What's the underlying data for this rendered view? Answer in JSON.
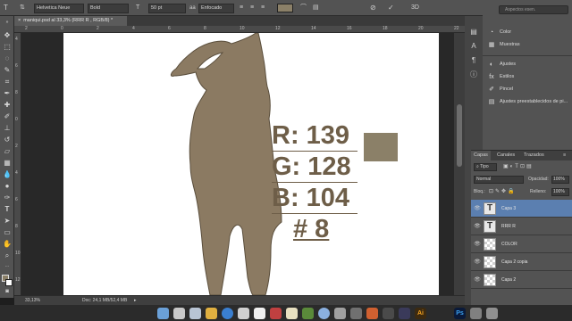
{
  "options_bar": {
    "font_family": "Helvetica Neue",
    "font_style": "Bold",
    "font_size": "50 pt",
    "antialias": "Enfocado",
    "text_color": "#8b8068"
  },
  "document": {
    "tab_title": "maniqui.psd al 33,3% (RRR    R , RGB/8) *",
    "zoom": "33,13%",
    "doc_size": "Doc: 24,1 MB/52,4 MB"
  },
  "rulers": {
    "top": [
      "2",
      "0",
      "2",
      "4",
      "6",
      "8",
      "10",
      "12",
      "14",
      "16",
      "18",
      "20",
      "22"
    ],
    "left": [
      "4",
      "6",
      "8",
      "0",
      "2",
      "4",
      "6",
      "8",
      "10",
      "12"
    ]
  },
  "canvas_text": {
    "r": "R: 139",
    "g": "G: 128",
    "b": "B: 104",
    "hash": "# 8"
  },
  "colors": {
    "swatch": "#8b8068",
    "silhouette": "#8b7a62",
    "accent": "#5b7fb0"
  },
  "right_panels": {
    "search_placeholder": "Aspectos esen.",
    "group1": [
      {
        "icon": "color-icon",
        "label": "Color"
      },
      {
        "icon": "swatches-icon",
        "label": "Muestras"
      }
    ],
    "group2": [
      {
        "icon": "adjustments-icon",
        "label": "Ajustes"
      },
      {
        "icon": "styles-icon",
        "label": "Estilos"
      },
      {
        "icon": "brush-icon",
        "label": "Pincel"
      },
      {
        "icon": "presets-icon",
        "label": "Ajustes preestablecidos de pi..."
      }
    ]
  },
  "layers_panel": {
    "tabs": [
      "Capas",
      "Canales",
      "Trazados"
    ],
    "filter": "Tipo",
    "blend_mode": "Normal",
    "opacity_label": "Opacidad:",
    "opacity_value": "100%",
    "lock_label": "Bloq.:",
    "fill_label": "Relleno:",
    "fill_value": "100%",
    "layers": [
      {
        "name": "Capa 3",
        "kind": "text",
        "selected": true
      },
      {
        "name": "RRR    R",
        "kind": "text",
        "selected": false
      },
      {
        "name": "COLOR",
        "kind": "pixel",
        "selected": false
      },
      {
        "name": "Capa 2 copia",
        "kind": "pixel",
        "selected": false
      },
      {
        "name": "Capa 2",
        "kind": "pixel",
        "selected": false
      }
    ]
  }
}
